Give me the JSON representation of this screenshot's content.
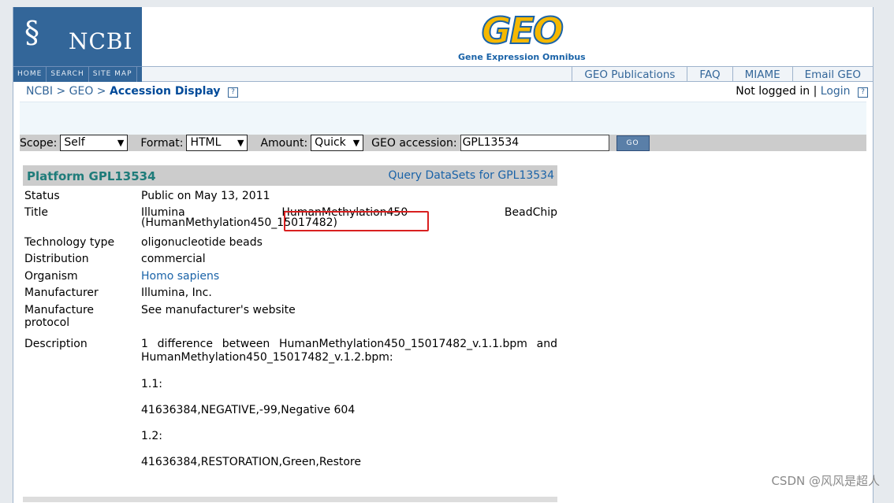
{
  "header": {
    "ncbi_logo_text": "NCBI",
    "geo_logo_text": "GEO",
    "geo_subtitle": "Gene Expression Omnibus",
    "nav": [
      "HOME",
      "SEARCH",
      "SITE MAP"
    ],
    "top_links": [
      "GEO Publications",
      "FAQ",
      "MIAME",
      "Email GEO"
    ]
  },
  "breadcrumb": {
    "ncbi": "NCBI",
    "sep": ">",
    "geo": "GEO",
    "current": "Accession Display",
    "help_icon": "?"
  },
  "login": {
    "status": "Not logged in",
    "sep": "|",
    "login_link": "Login",
    "help_icon": "?"
  },
  "controls": {
    "scope_label": "Scope:",
    "scope_value": "Self",
    "format_label": "Format:",
    "format_value": "HTML",
    "amount_label": "Amount:",
    "amount_value": "Quick",
    "accession_label": "GEO accession:",
    "accession_value": "GPL13534",
    "go_label": "GO"
  },
  "platform": {
    "title": "Platform GPL13534",
    "query_link": "Query DataSets for GPL13534",
    "fields": {
      "status_k": "Status",
      "status_v": "Public on May 13, 2011",
      "title_k": "Title",
      "title_v1": "Illumina",
      "title_v2": "HumanMethylation450",
      "title_v3": "BeadChip",
      "title_v4": "(HumanMethylation450_15017482)",
      "tech_k": "Technology type",
      "tech_v": "oligonucleotide beads",
      "dist_k": "Distribution",
      "dist_v": "commercial",
      "org_k": "Organism",
      "org_v": "Homo sapiens",
      "manu_k": "Manufacturer",
      "manu_v": "Illumina, Inc.",
      "proto_k": "Manufacture protocol",
      "proto_v": "See manufacturer's website",
      "desc_k": "Description",
      "desc_v1": "1 difference between HumanMethylation450_15017482_v.1.1.bpm and HumanMethylation450_15017482_v.1.2.bpm:",
      "desc_v2": "1.1:",
      "desc_v3": "41636384,NEGATIVE,-99,Negative 604",
      "desc_v4": "1.2:",
      "desc_v5": "41636384,RESTORATION,Green,Restore"
    }
  },
  "watermark": "CSDN @风风是超人"
}
